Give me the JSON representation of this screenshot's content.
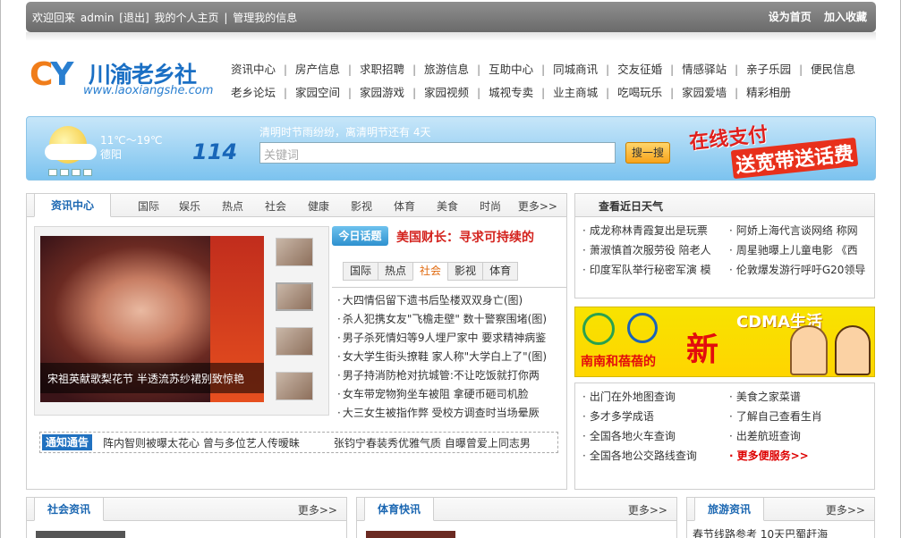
{
  "topbar": {
    "welcome": "欢迎回来",
    "user": "admin",
    "logout": "[退出]",
    "home": "我的个人主页",
    "sep": "|",
    "manage": "管理我的信息",
    "set_home": "设为首页",
    "favorite": "加入收藏"
  },
  "logo": {
    "mark_c": "C",
    "mark_y": "Y",
    "name": "川渝老乡社",
    "url": "www.laoxiangshe.com"
  },
  "nav": {
    "row1": [
      "资讯中心",
      "房产信息",
      "求职招聘",
      "旅游信息",
      "互助中心",
      "同城商讯",
      "交友征婚",
      "情感驿站",
      "亲子乐园",
      "便民信息"
    ],
    "row2": [
      "老乡论坛",
      "家园空间",
      "家园游戏",
      "家园视频",
      "城视专卖",
      "业主商城",
      "吃喝玩乐",
      "家园爱墙",
      "精彩相册"
    ],
    "sep": "|"
  },
  "banner": {
    "temp": "11℃～19℃",
    "city": "德阳",
    "number": "114",
    "notice": "清明时节雨纷纷，离清明节还有 4天",
    "search_placeholder": "关键词",
    "search_btn": "搜一搜",
    "promo1": "在线支付",
    "promo2": "送宽带送话费"
  },
  "news": {
    "tab_current": "资讯中心",
    "tabs": [
      "国际",
      "娱乐",
      "热点",
      "社会",
      "健康",
      "影视",
      "体育",
      "美食",
      "时尚"
    ],
    "more": "更多>>",
    "photo_caption": "宋祖英献歌梨花节 半透流苏纱裙别致惊艳",
    "today_label": "今日话题",
    "today_title": "美国财长：寻求可持续的",
    "sub_tabs": [
      "国际",
      "热点",
      "社会",
      "影视",
      "体育"
    ],
    "items": [
      "大四情侣留下遗书后坠楼双双身亡(图)",
      "杀人犯携女友\"飞檐走壁\" 数十警察围堵(图)",
      "男子杀死情妇等9人埋尸家中  要求精神病鉴",
      "女大学生街头撩鞋 家人称\"大学白上了\"(图)",
      "男子持消防枪对抗城管:不让吃饭就打你两",
      "女车带宠物狗坐车被阻 拿硬币砸司机脸",
      "大三女生被指作弊 受校方调查时当场晕厥"
    ],
    "notice_label": "通知通告",
    "notice1": "阵内智则被曝太花心 曾与多位艺人传暧昧",
    "notice2": "张钧宁春装秀优雅气质 自曝曾爱上同志男"
  },
  "weather": {
    "title": "查看近日天气",
    "left": [
      "成龙称林青霞复出是玩票",
      "萧淑慎首次服劳役 陪老人",
      "印度军队举行秘密军演 模"
    ],
    "right": [
      "阿娇上海代言谈网络 称网",
      "周星驰曝上儿童电影 《西",
      "伦敦爆发游行呼吁G20领导"
    ]
  },
  "ad": {
    "brand": "CDMA生活",
    "slogan": "南南和蓓蓓的",
    "big": "新"
  },
  "services": {
    "left": [
      "出门在外地图查询",
      "多才多学成语",
      "全国各地火车查询",
      "全国各地公交路线查询"
    ],
    "right": [
      "美食之家菜谱",
      "了解自己查看生肖",
      "出差航班查询",
      "更多便服务>>"
    ]
  },
  "bottom": {
    "social": {
      "title": "社会资讯",
      "more": "更多>>"
    },
    "sports": {
      "title": "体育快讯",
      "more": "更多>>"
    },
    "travel": {
      "title": "旅游资讯",
      "more": "更多>>",
      "line": "春节线路参考  10天巴蜀赶海"
    }
  },
  "colors": {
    "accent": "#1b67b2",
    "hot_red": "#d4231e",
    "active_tab": "#e06a0f"
  }
}
